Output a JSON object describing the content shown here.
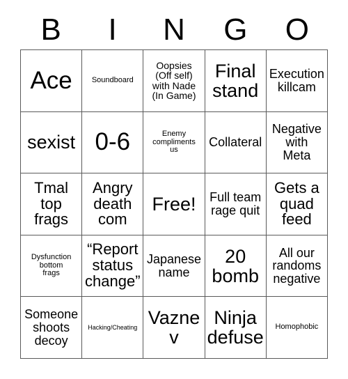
{
  "card": {
    "title": "BINGO",
    "header_letters": [
      "B",
      "I",
      "N",
      "G",
      "O"
    ],
    "free_space_label": "Free!",
    "colors": {
      "background": "#ffffff",
      "text": "#000000",
      "grid_line": "#5a5a5a"
    },
    "rows": [
      [
        {
          "text": "Ace",
          "size": "fs-xxl"
        },
        {
          "text": "Soundboard",
          "size": "fs-xs"
        },
        {
          "text": "Oopsies\n(Off self)\nwith Nade\n(In Game)",
          "size": "fs-sm"
        },
        {
          "text": "Final\nstand",
          "size": "fs-xl"
        },
        {
          "text": "Execution\nkillcam",
          "size": "fs-md"
        }
      ],
      [
        {
          "text": "sexist",
          "size": "fs-xl"
        },
        {
          "text": "0-6",
          "size": "fs-xxl"
        },
        {
          "text": "Enemy\ncompliments\nus",
          "size": "fs-xs"
        },
        {
          "text": "Collateral",
          "size": "fs-md"
        },
        {
          "text": "Negative\nwith\nMeta",
          "size": "fs-md"
        }
      ],
      [
        {
          "text": "Tmal\ntop\nfrags",
          "size": "fs-lg"
        },
        {
          "text": "Angry\ndeath\ncom",
          "size": "fs-lg"
        },
        {
          "text": "Free!",
          "size": "fs-xl"
        },
        {
          "text": "Full team\nrage quit",
          "size": "fs-md"
        },
        {
          "text": "Gets a\nquad\nfeed",
          "size": "fs-lg"
        }
      ],
      [
        {
          "text": "Dysfunction\nbottom\nfrags",
          "size": "fs-xs"
        },
        {
          "text": "“Report\nstatus\nchange”",
          "size": "fs-lg"
        },
        {
          "text": "Japanese\nname",
          "size": "fs-md"
        },
        {
          "text": "20\nbomb",
          "size": "fs-xl"
        },
        {
          "text": "All our\nrandoms\nnegative",
          "size": "fs-md"
        }
      ],
      [
        {
          "text": "Someone\nshoots\ndecoy",
          "size": "fs-md"
        },
        {
          "text": "Hacking/Cheating",
          "size": "fs-xxs"
        },
        {
          "text": "Vaznev",
          "size": "fs-xl"
        },
        {
          "text": "Ninja\ndefuse",
          "size": "fs-xl"
        },
        {
          "text": "Homophobic",
          "size": "fs-xs"
        }
      ]
    ]
  }
}
